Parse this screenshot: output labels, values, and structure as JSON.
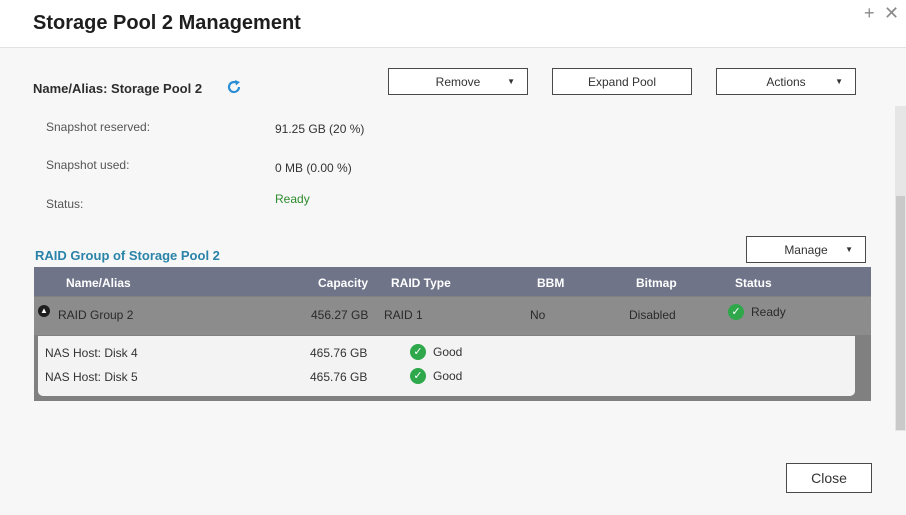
{
  "window": {
    "title": "Storage Pool 2 Management",
    "plus_glyph": "+",
    "close_glyph": "✕"
  },
  "pool": {
    "name_alias_text": "Name/Alias: Storage Pool 2"
  },
  "toolbar": {
    "remove_label": "Remove",
    "expand_label": "Expand Pool",
    "actions_label": "Actions"
  },
  "info": {
    "snapshot_reserved_label": "Snapshot reserved:",
    "snapshot_reserved_value": "91.25 GB (20 %)",
    "snapshot_used_label": "Snapshot used:",
    "snapshot_used_value": "0 MB (0.00 %)",
    "status_label": "Status:",
    "status_value": "Ready"
  },
  "raid_section": {
    "title": "RAID Group of Storage Pool 2",
    "manage_label": "Manage"
  },
  "table": {
    "headers": {
      "name": "Name/Alias",
      "capacity": "Capacity",
      "raid_type": "RAID Type",
      "bbm": "BBM",
      "bitmap": "Bitmap",
      "status": "Status"
    },
    "group": {
      "name": "RAID Group 2",
      "capacity": "456.27 GB",
      "raid_type": "RAID 1",
      "bbm": "No",
      "bitmap": "Disabled",
      "status": "Ready"
    },
    "disks": [
      {
        "name": "NAS Host: Disk 4",
        "capacity": "465.76 GB",
        "status": "Good"
      },
      {
        "name": "NAS Host: Disk 5",
        "capacity": "465.76 GB",
        "status": "Good"
      }
    ]
  },
  "footer": {
    "close_label": "Close"
  },
  "colors": {
    "accent_title": "#2a83a8",
    "table_header": "#6f7489",
    "ok_green": "#2ea84a",
    "status_green": "#2e8b2e"
  },
  "icons": [
    "refresh-icon",
    "chevron-down-icon",
    "collapse-icon",
    "check-circle-icon",
    "plus-icon",
    "close-icon"
  ]
}
